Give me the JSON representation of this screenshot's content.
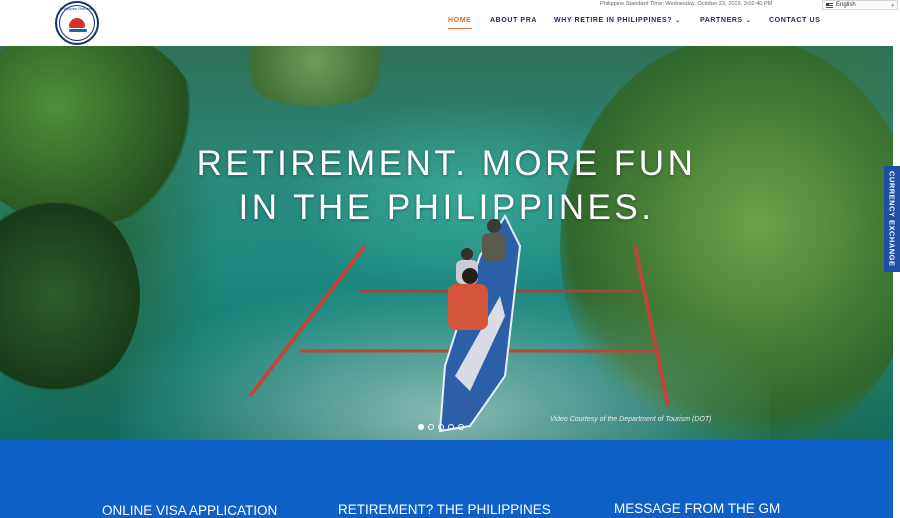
{
  "header": {
    "logo_name": "pra-logo",
    "logo_text": "Philippine Retirement Authority",
    "time_label": "Philippine Standard Time: Wednesday, October 23, 2019, 3:02:40 PM",
    "language": "English",
    "nav": [
      {
        "label": "HOME",
        "active": true,
        "dropdown": false
      },
      {
        "label": "ABOUT PRA",
        "active": false,
        "dropdown": false
      },
      {
        "label": "WHY RETIRE IN PHILIPPINES?",
        "active": false,
        "dropdown": true
      },
      {
        "label": "PARTNERS",
        "active": false,
        "dropdown": true
      },
      {
        "label": "CONTACT US",
        "active": false,
        "dropdown": false
      }
    ],
    "accent_color": "#e06a36",
    "nav_color": "#1f2a5c"
  },
  "hero": {
    "title_line1": "RETIREMENT. MORE FUN",
    "title_line2": "IN THE PHILIPPINES.",
    "credit": "Video Courtesy of the Department of Tourism (DOT)",
    "slides": 5,
    "active_slide": 0
  },
  "side_tab": {
    "label": "CURRENCY EXCHANGE",
    "color": "#1f4fa0"
  },
  "band": {
    "color": "#0e5fc6",
    "links": [
      "ONLINE VISA APPLICATION",
      "RETIREMENT? THE PHILIPPINES",
      "MESSAGE FROM THE GM"
    ]
  }
}
